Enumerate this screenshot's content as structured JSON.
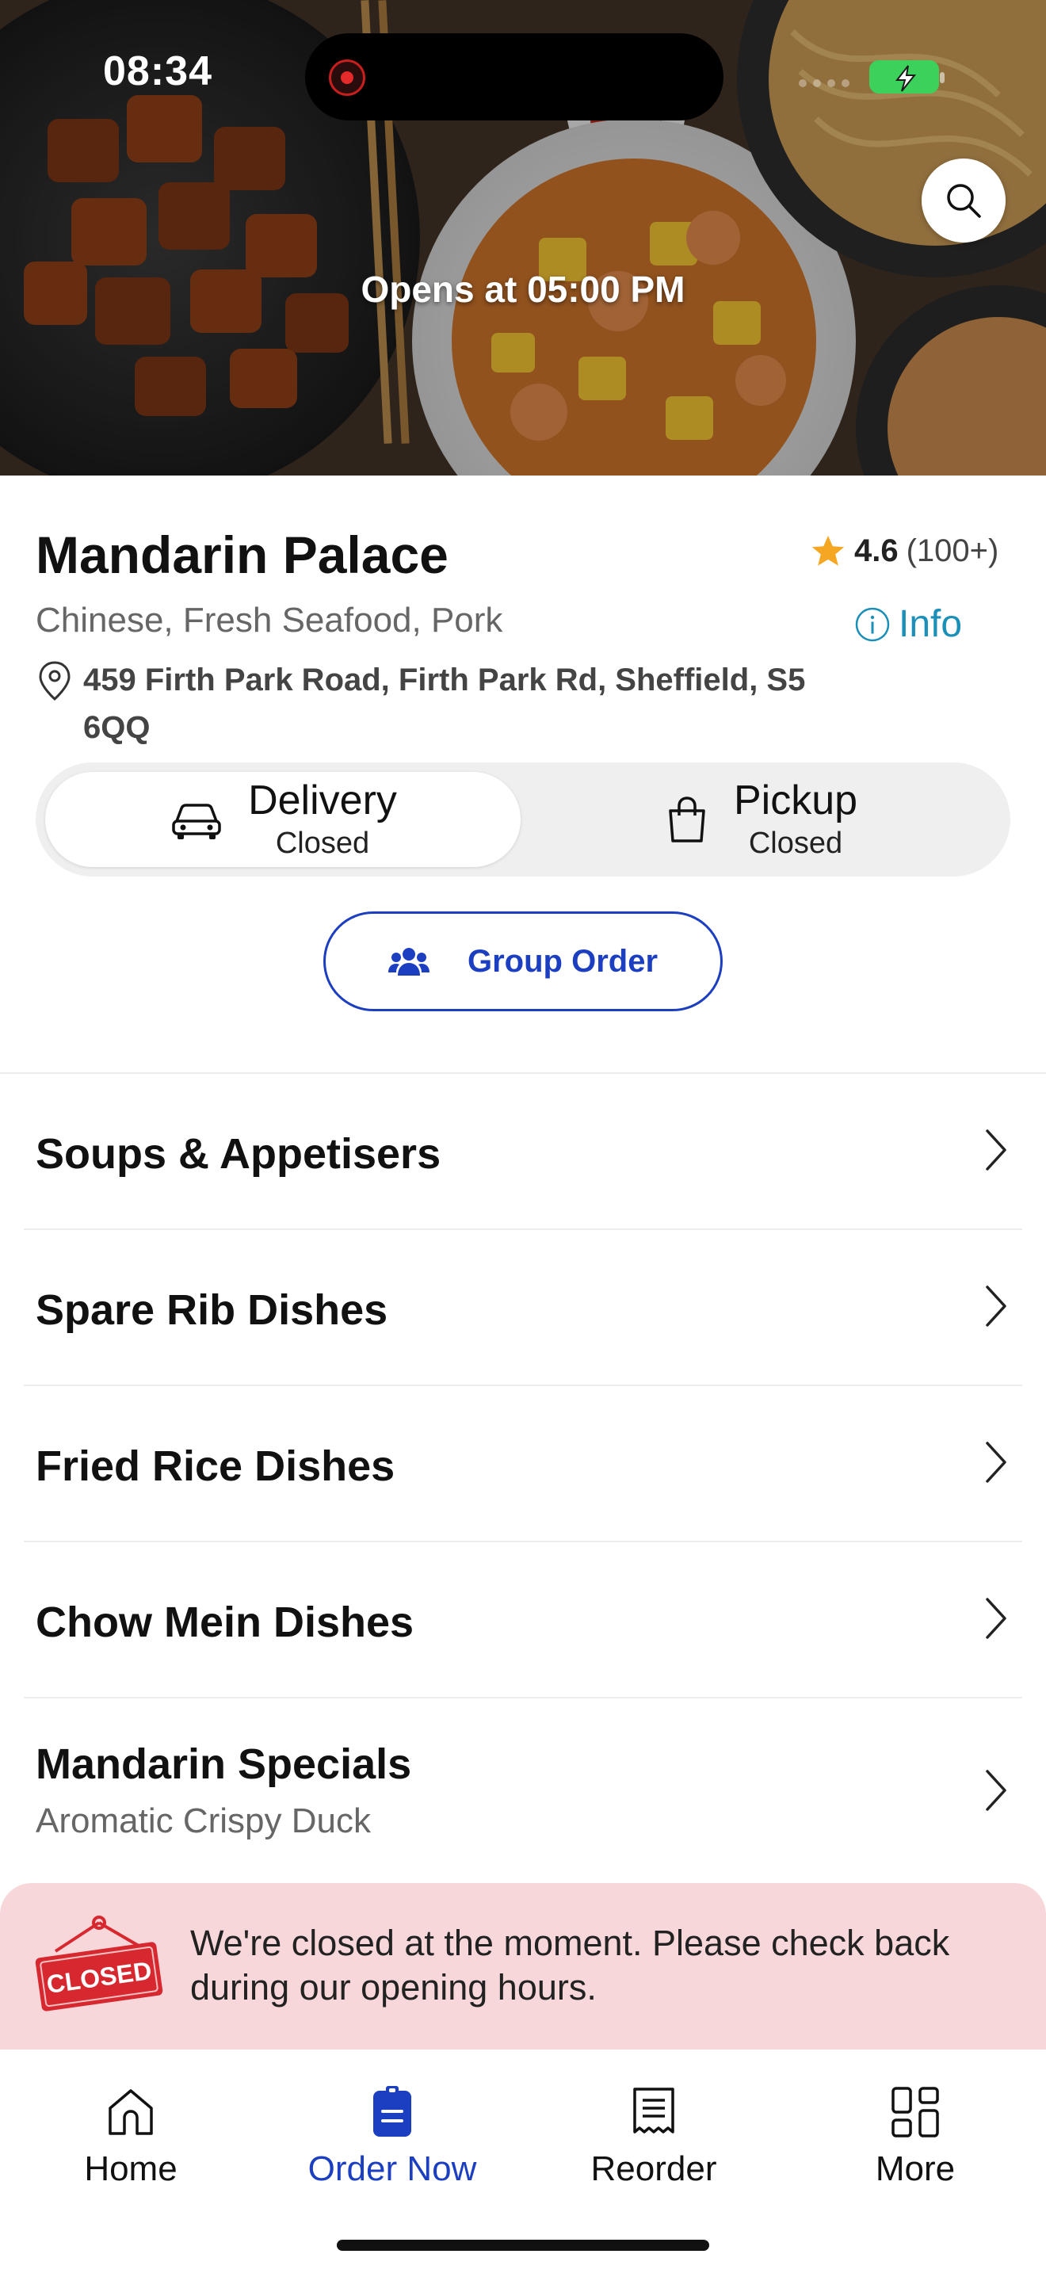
{
  "status_bar": {
    "time": "08:34"
  },
  "hero": {
    "opens_text": "Opens at 05:00 PM"
  },
  "restaurant": {
    "name": "Mandarin Palace",
    "rating": "4.6",
    "rating_count": "(100+)",
    "cuisine": "Chinese, Fresh Seafood, Pork",
    "info_label": "Info",
    "address": "459 Firth Park Road, Firth Park Rd, Sheffield, S5 6QQ"
  },
  "modes": [
    {
      "label": "Delivery",
      "status": "Closed",
      "selected": true
    },
    {
      "label": "Pickup",
      "status": "Closed",
      "selected": false
    }
  ],
  "group_order": {
    "label": "Group Order"
  },
  "categories": [
    {
      "label": "Soups & Appetisers"
    },
    {
      "label": "Spare Rib Dishes"
    },
    {
      "label": "Fried Rice Dishes"
    },
    {
      "label": "Chow Mein Dishes"
    },
    {
      "label": "Mandarin Specials",
      "subtitle": "Aromatic Crispy Duck"
    }
  ],
  "closed_banner": {
    "sign_text": "CLOSED",
    "message": "We're closed at the moment. Please check back during our opening hours."
  },
  "tabbar": [
    {
      "label": "Home",
      "icon": "home-icon"
    },
    {
      "label": "Order Now",
      "icon": "order-icon",
      "active": true
    },
    {
      "label": "Reorder",
      "icon": "receipt-icon"
    },
    {
      "label": "More",
      "icon": "grid-icon"
    }
  ],
  "colors": {
    "accent": "#1c3fc1",
    "info": "#1a8fb8",
    "star": "#f5a623",
    "closed_banner_bg": "#f8d7da",
    "closed_sign": "#d7282f"
  }
}
